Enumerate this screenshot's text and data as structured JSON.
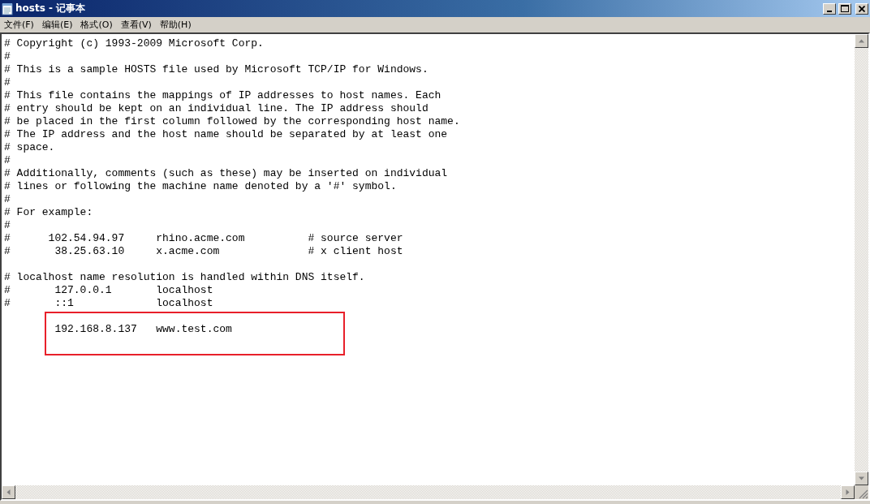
{
  "window": {
    "title": "hosts - 记事本"
  },
  "menu": [
    {
      "label": "文件(F)"
    },
    {
      "label": "编辑(E)"
    },
    {
      "label": "格式(O)"
    },
    {
      "label": "查看(V)"
    },
    {
      "label": "帮助(H)"
    }
  ],
  "lines": [
    {
      "kind": "text",
      "text": "# Copyright (c) 1993-2009 Microsoft Corp."
    },
    {
      "kind": "text",
      "text": "#"
    },
    {
      "kind": "text",
      "text": "# This is a sample HOSTS file used by Microsoft TCP/IP for Windows."
    },
    {
      "kind": "text",
      "text": "#"
    },
    {
      "kind": "text",
      "text": "# This file contains the mappings of IP addresses to host names. Each"
    },
    {
      "kind": "text",
      "text": "# entry should be kept on an individual line. The IP address should"
    },
    {
      "kind": "text",
      "text": "# be placed in the first column followed by the corresponding host name."
    },
    {
      "kind": "text",
      "text": "# The IP address and the host name should be separated by at least one"
    },
    {
      "kind": "text",
      "text": "# space."
    },
    {
      "kind": "text",
      "text": "#"
    },
    {
      "kind": "text",
      "text": "# Additionally, comments (such as these) may be inserted on individual"
    },
    {
      "kind": "text",
      "text": "# lines or following the machine name denoted by a '#' symbol."
    },
    {
      "kind": "text",
      "text": "#"
    },
    {
      "kind": "text",
      "text": "# For example:"
    },
    {
      "kind": "text",
      "text": "#"
    },
    {
      "kind": "text",
      "text": "#      102.54.94.97     rhino.acme.com          # source server"
    },
    {
      "kind": "text",
      "text": "#       38.25.63.10     x.acme.com              # x client host"
    },
    {
      "kind": "blank"
    },
    {
      "kind": "text",
      "text": "# localhost name resolution is handled within DNS itself."
    },
    {
      "kind": "text",
      "text": "#       127.0.0.1       localhost"
    },
    {
      "kind": "text",
      "text": "#       ::1             localhost"
    },
    {
      "kind": "blank"
    },
    {
      "kind": "highlighted",
      "text": "        192.168.8.137   www.test.com"
    }
  ]
}
